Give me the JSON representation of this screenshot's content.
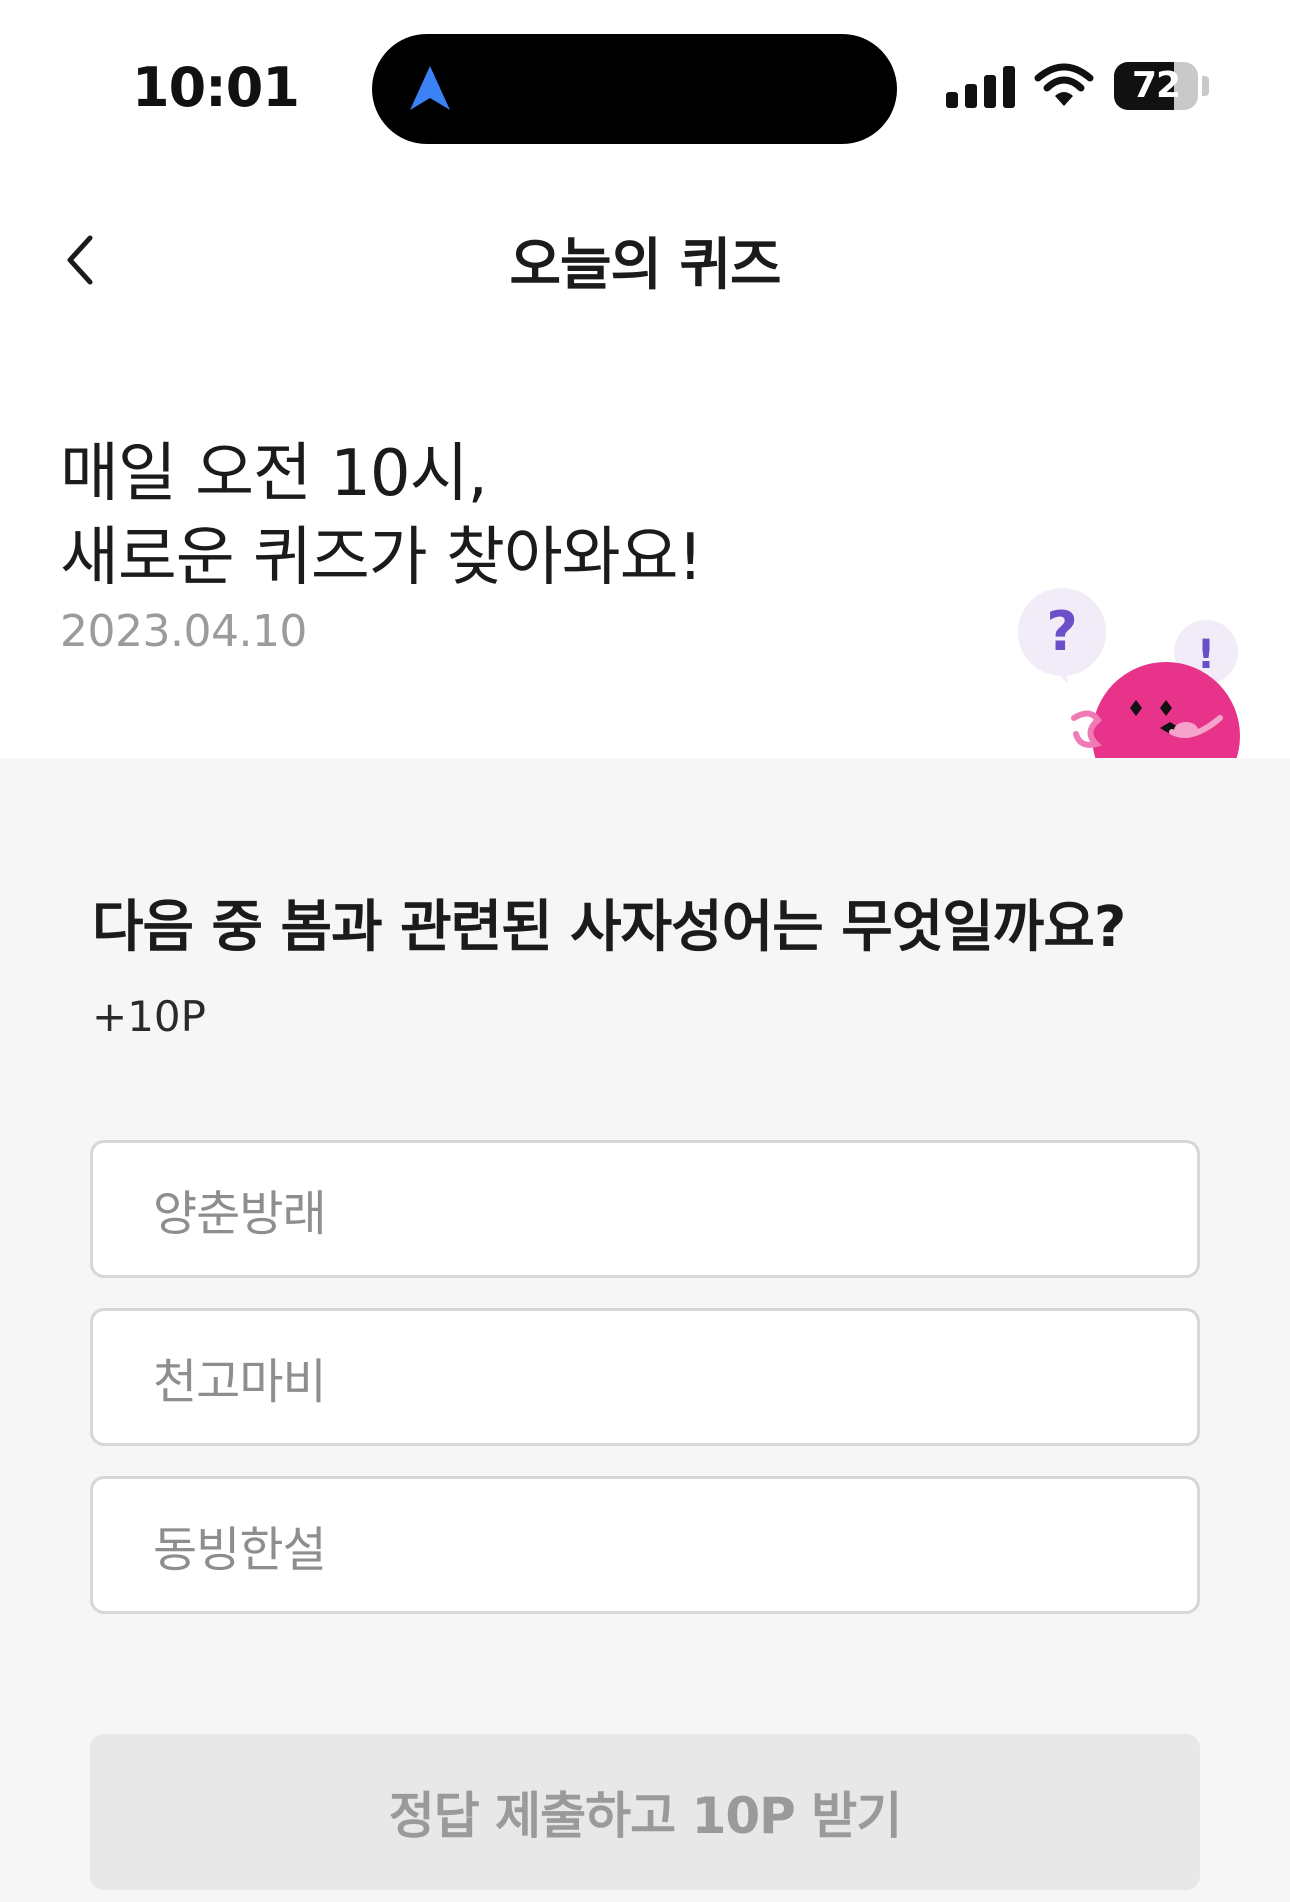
{
  "status_bar": {
    "time": "10:01",
    "battery_level": "72",
    "battery_fraction": 0.72,
    "icons": [
      "location-arrow-icon",
      "signal-icon",
      "wifi-icon",
      "battery-icon"
    ],
    "nav_arrow_color": "#3b82f6"
  },
  "header": {
    "title": "오늘의 퀴즈",
    "back_icon": "chevron-left-icon"
  },
  "intro": {
    "line1": "매일 오전 10시,",
    "line2": "새로운 퀴즈가 찾아와요!",
    "date": "2023.04.10"
  },
  "mascot": {
    "question_mark": "?",
    "exclamation_mark": "!",
    "body_color": "#e8338a",
    "bubble_color": "#f1ecf7"
  },
  "quiz": {
    "question": "다음 중 봄과 관련된 사자성어는 무엇일까요?",
    "points": "+10P",
    "options": [
      {
        "label": "양춘방래"
      },
      {
        "label": "천고마비"
      },
      {
        "label": "동빙한설"
      }
    ],
    "submit_label": "정답 제출하고 10P 받기"
  }
}
